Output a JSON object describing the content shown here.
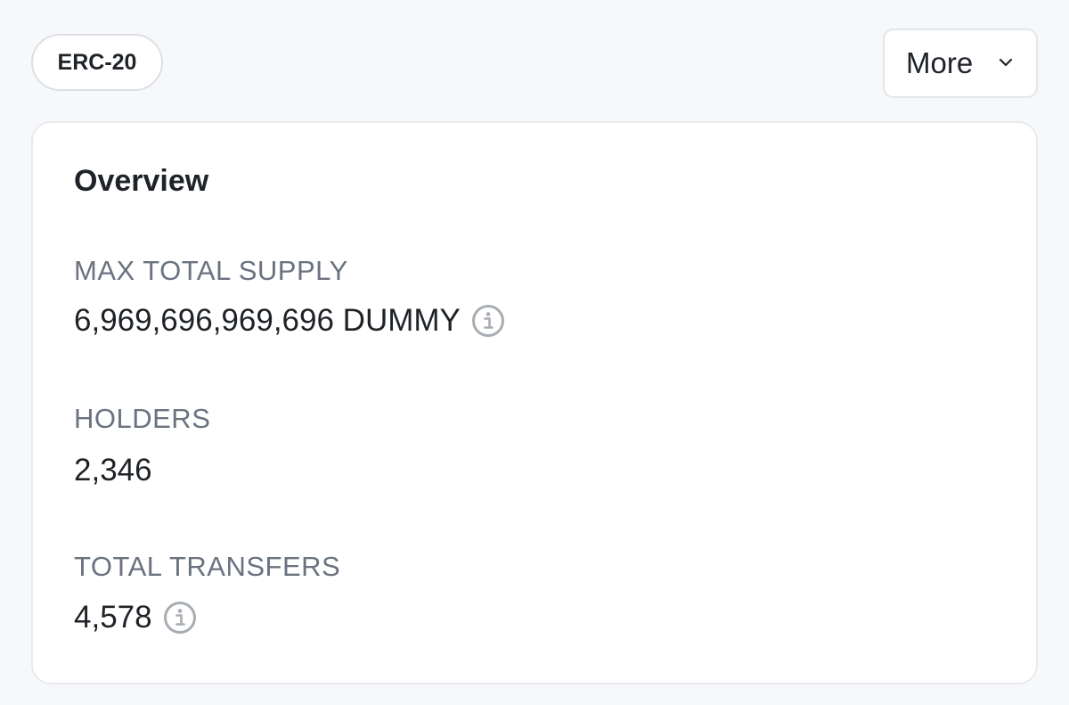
{
  "header": {
    "badge_label": "ERC-20",
    "more_label": "More"
  },
  "overview": {
    "title": "Overview",
    "stats": [
      {
        "label": "MAX TOTAL SUPPLY",
        "value": "6,969,696,969,696 DUMMY",
        "icon": "info-icon"
      },
      {
        "label": "HOLDERS",
        "value": "2,346"
      },
      {
        "label": "TOTAL TRANSFERS",
        "value": "4,578",
        "icon": "info-icon"
      }
    ]
  },
  "colors": {
    "background": "#f7f8fa",
    "card": "#ffffff",
    "text": "#1f2328",
    "muted": "#6b7280",
    "icon": "#a8adb4"
  }
}
